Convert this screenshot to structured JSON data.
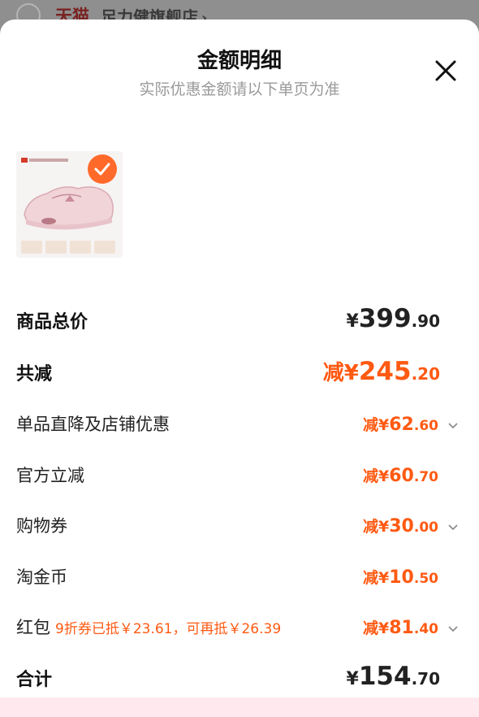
{
  "background": {
    "store_brand": "天猫",
    "store_name": "足力健旗舰店",
    "store_chevron": "›"
  },
  "sheet": {
    "title": "金额明细",
    "subtitle": "实际优惠金额请以下单页为准",
    "close_icon": "close-icon"
  },
  "product": {
    "image_icon": "product-thumbnail",
    "selected": true
  },
  "rows": [
    {
      "label": "商品总价",
      "prefix": "¥",
      "int": "399",
      "cents": ".90",
      "emphasis": "dark"
    },
    {
      "label": "共减",
      "prefix": "减¥",
      "int": "245",
      "cents": ".20",
      "emphasis": "accent"
    },
    {
      "label": "单品直降及店铺优惠",
      "prefix": "减¥",
      "int": "62",
      "cents": ".60",
      "has_chevron": true
    },
    {
      "label": "官方立减",
      "prefix": "减¥",
      "int": "60",
      "cents": ".70",
      "has_chevron": false
    },
    {
      "label": "购物券",
      "prefix": "减¥",
      "int": "30",
      "cents": ".00",
      "has_chevron": true
    },
    {
      "label": "淘金币",
      "prefix": "减¥",
      "int": "10",
      "cents": ".50",
      "has_chevron": false
    },
    {
      "label": "红包",
      "note": "9折券已抵￥23.61，可再抵￥26.39",
      "prefix": "减¥",
      "int": "81",
      "cents": ".40",
      "has_chevron": true
    },
    {
      "label": "合计",
      "prefix": "¥",
      "int": "154",
      "cents": ".70",
      "emphasis": "dark"
    }
  ],
  "colors": {
    "accent": "#ff5a12",
    "text": "#222222",
    "muted": "#9a9a9a"
  }
}
